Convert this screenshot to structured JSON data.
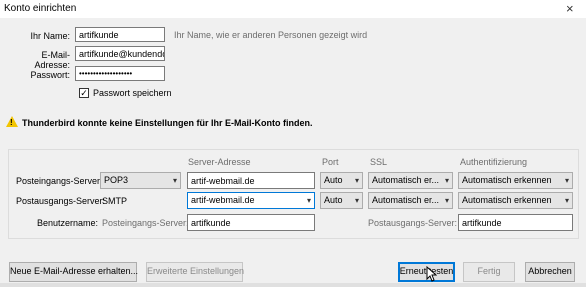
{
  "window": {
    "title": "Konto einrichten",
    "close": "×"
  },
  "account": {
    "name_label": "Ihr Name:",
    "name_value": "artifkunde",
    "name_hint": "Ihr Name, wie er anderen Personen gezeigt wird",
    "email_label": "E-Mail-Adresse:",
    "email_value": "artifkunde@kundendo",
    "password_label": "Passwort:",
    "password_value": "•••••••••••••••••••",
    "remember_label": "Passwort speichern",
    "remember_checked": true,
    "remember_mark": "✓"
  },
  "warning": {
    "text": "Thunderbird konnte keine Einstellungen für Ihr E-Mail-Konto finden.",
    "mark": "!"
  },
  "server": {
    "headers": {
      "address": "Server-Adresse",
      "port": "Port",
      "ssl": "SSL",
      "auth": "Authentifizierung"
    },
    "incoming": {
      "label": "Posteingangs-Server:",
      "protocol": "POP3",
      "address": "artif-webmail.de",
      "port": "Auto",
      "ssl": "Automatisch er...",
      "auth": "Automatisch erkennen"
    },
    "outgoing": {
      "label": "Postausgangs-Server:",
      "protocol": "SMTP",
      "address": "artif-webmail.de",
      "port": "Auto",
      "ssl": "Automatisch er...",
      "auth": "Automatisch erkennen"
    },
    "username": {
      "label": "Benutzername:",
      "incoming_label": "Posteingangs-Server:",
      "incoming_value": "artifkunde",
      "outgoing_label": "Postausgangs-Server:",
      "outgoing_value": "artifkunde"
    }
  },
  "buttons": {
    "new_email": "Neue E-Mail-Adresse erhalten...",
    "advanced": "Erweiterte Einstellungen",
    "retest": "Erneut testen",
    "done": "Fertig",
    "cancel": "Abbrechen"
  },
  "icons": {
    "dropdown": "chevron-down-icon",
    "warning": "warning-icon",
    "cursor": "mouse-cursor-icon"
  }
}
